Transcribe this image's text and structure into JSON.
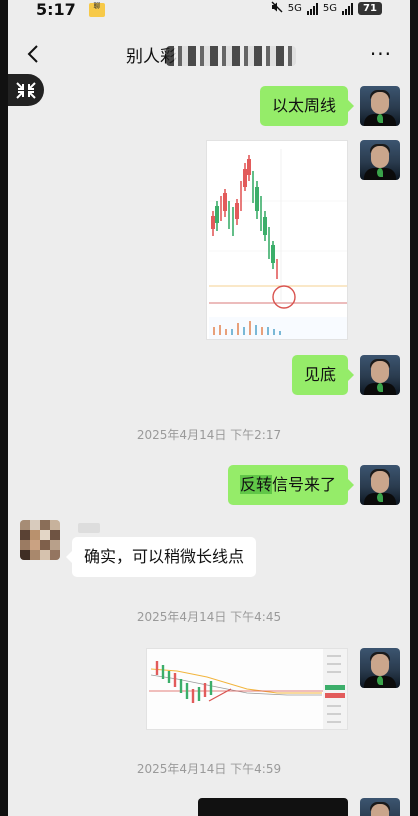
{
  "status": {
    "time": "5:17",
    "badge": "聊",
    "net1": "5G",
    "net2": "5G",
    "battery": "71"
  },
  "header": {
    "title": "别人彩"
  },
  "messages": [
    {
      "side": "me",
      "text": "以太周线"
    },
    {
      "side": "me",
      "type": "image",
      "content": "ETH weekly candlestick chart"
    },
    {
      "side": "me",
      "text": "见底"
    },
    {
      "side": "system",
      "text": "2025年4月14日 下午2:17"
    },
    {
      "side": "me",
      "text_parts": [
        "反转",
        "信号来了"
      ]
    },
    {
      "side": "other",
      "text": "确实，可以稍微长线点"
    },
    {
      "side": "system",
      "text": "2025年4月14日 下午4:45"
    },
    {
      "side": "me",
      "type": "image",
      "content": "candlestick chart screenshot"
    },
    {
      "side": "system",
      "text": "2025年4月14日 下午4:59"
    }
  ],
  "colors": {
    "bubble_me": "#95ec69",
    "bubble_other": "#ffffff",
    "background": "#ededed",
    "highlight": "#61c748"
  }
}
